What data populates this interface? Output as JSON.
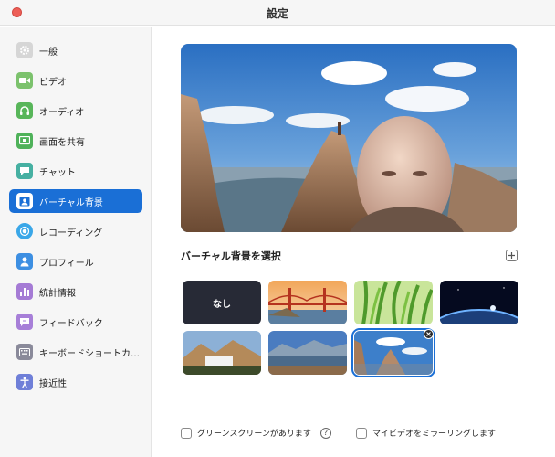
{
  "window": {
    "title": "設定"
  },
  "sidebar": {
    "items": [
      {
        "label": "一般",
        "icon": "gear-icon",
        "color": "#c9c9c9"
      },
      {
        "label": "ビデオ",
        "icon": "video-camera-icon",
        "color": "#7cc26d"
      },
      {
        "label": "オーディオ",
        "icon": "headphones-icon",
        "color": "#58b65a"
      },
      {
        "label": "画面を共有",
        "icon": "share-screen-icon",
        "color": "#4fb25a"
      },
      {
        "label": "チャット",
        "icon": "chat-bubble-icon",
        "color": "#46b0a2"
      },
      {
        "label": "バーチャル背景",
        "icon": "person-portrait-icon",
        "color": "#1a6fd6",
        "active": true
      },
      {
        "label": "レコーディング",
        "icon": "record-icon",
        "color": "#3aa7e8"
      },
      {
        "label": "プロフィール",
        "icon": "user-icon",
        "color": "#3d8fe2"
      },
      {
        "label": "統計情報",
        "icon": "bar-chart-icon",
        "color": "#a57bd5"
      },
      {
        "label": "フィードバック",
        "icon": "feedback-icon",
        "color": "#a77fd8"
      },
      {
        "label": "キーボードショートカ…",
        "icon": "keyboard-icon",
        "color": "#8a8a9a"
      },
      {
        "label": "接近性",
        "icon": "accessibility-icon",
        "color": "#6f7fd8"
      }
    ]
  },
  "main": {
    "section_title": "バーチャル背景を選択",
    "none_label": "なし",
    "backgrounds": [
      {
        "name": "none"
      },
      {
        "name": "golden-gate-bridge"
      },
      {
        "name": "grass"
      },
      {
        "name": "earth-from-space"
      },
      {
        "name": "mountain-town"
      },
      {
        "name": "mountain-lake"
      },
      {
        "name": "rocky-peak",
        "selected": true
      }
    ],
    "green_screen_label": "グリーンスクリーンがあります",
    "help_mark": "?",
    "mirror_label": "マイビデオをミラーリングします"
  },
  "colors": {
    "accent": "#1a6fd6",
    "close": "#ed5f57"
  }
}
